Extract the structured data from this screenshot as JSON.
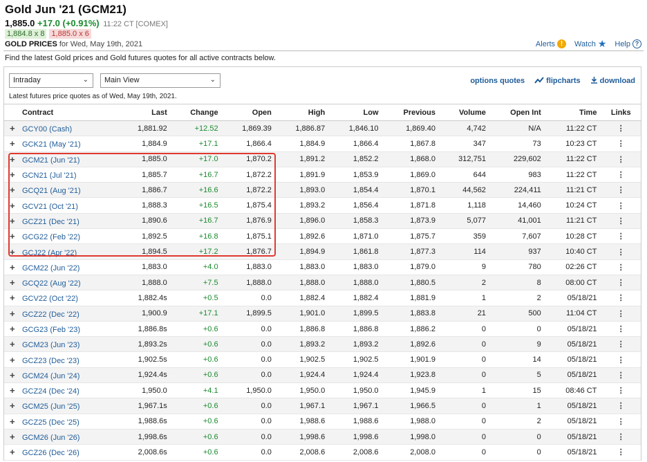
{
  "header": {
    "title": "Gold Jun '21 (GCM21)",
    "last": "1,885.0",
    "change": "+17.0 (+0.91%)",
    "time": "11:22 CT [COMEX]",
    "bid": "1,884.8 x 8",
    "ask": "1,885.0 x 6",
    "prices_label": "GOLD PRICES",
    "prices_date": "for Wed, May 19th, 2021"
  },
  "top_links": {
    "alerts": "Alerts",
    "watch": "Watch",
    "help": "Help"
  },
  "description": "Find the latest Gold prices and Gold futures quotes for all active contracts below.",
  "controls": {
    "view_type": "Intraday",
    "view_mode": "Main View",
    "options_quotes": "options quotes",
    "flipcharts": "flipcharts",
    "download": "download"
  },
  "latest_text": "Latest futures price quotes as of Wed, May 19th, 2021.",
  "table": {
    "headers": [
      "Contract",
      "Last",
      "Change",
      "Open",
      "High",
      "Low",
      "Previous",
      "Volume",
      "Open Int",
      "Time",
      "Links"
    ],
    "rows": [
      [
        "GCY00 (Cash)",
        "1,881.92",
        "+12.52",
        "1,869.39",
        "1,886.87",
        "1,846.10",
        "1,869.40",
        "4,742",
        "N/A",
        "11:22 CT"
      ],
      [
        "GCK21 (May '21)",
        "1,884.9",
        "+17.1",
        "1,866.4",
        "1,884.9",
        "1,866.4",
        "1,867.8",
        "347",
        "73",
        "10:23 CT"
      ],
      [
        "GCM21 (Jun '21)",
        "1,885.0",
        "+17.0",
        "1,870.2",
        "1,891.2",
        "1,852.2",
        "1,868.0",
        "312,751",
        "229,602",
        "11:22 CT"
      ],
      [
        "GCN21 (Jul '21)",
        "1,885.7",
        "+16.7",
        "1,872.2",
        "1,891.9",
        "1,853.9",
        "1,869.0",
        "644",
        "983",
        "11:22 CT"
      ],
      [
        "GCQ21 (Aug '21)",
        "1,886.7",
        "+16.6",
        "1,872.2",
        "1,893.0",
        "1,854.4",
        "1,870.1",
        "44,562",
        "224,411",
        "11:21 CT"
      ],
      [
        "GCV21 (Oct '21)",
        "1,888.3",
        "+16.5",
        "1,875.4",
        "1,893.2",
        "1,856.4",
        "1,871.8",
        "1,118",
        "14,460",
        "10:24 CT"
      ],
      [
        "GCZ21 (Dec '21)",
        "1,890.6",
        "+16.7",
        "1,876.9",
        "1,896.0",
        "1,858.3",
        "1,873.9",
        "5,077",
        "41,001",
        "11:21 CT"
      ],
      [
        "GCG22 (Feb '22)",
        "1,892.5",
        "+16.8",
        "1,875.1",
        "1,892.6",
        "1,871.0",
        "1,875.7",
        "359",
        "7,607",
        "10:28 CT"
      ],
      [
        "GCJ22 (Apr '22)",
        "1,894.5",
        "+17.2",
        "1,876.7",
        "1,894.9",
        "1,861.8",
        "1,877.3",
        "114",
        "937",
        "10:40 CT"
      ],
      [
        "GCM22 (Jun '22)",
        "1,883.0",
        "+4.0",
        "1,883.0",
        "1,883.0",
        "1,883.0",
        "1,879.0",
        "9",
        "780",
        "02:26 CT"
      ],
      [
        "GCQ22 (Aug '22)",
        "1,888.0",
        "+7.5",
        "1,888.0",
        "1,888.0",
        "1,888.0",
        "1,880.5",
        "2",
        "8",
        "08:00 CT"
      ],
      [
        "GCV22 (Oct '22)",
        "1,882.4s",
        "+0.5",
        "0.0",
        "1,882.4",
        "1,882.4",
        "1,881.9",
        "1",
        "2",
        "05/18/21"
      ],
      [
        "GCZ22 (Dec '22)",
        "1,900.9",
        "+17.1",
        "1,899.5",
        "1,901.0",
        "1,899.5",
        "1,883.8",
        "21",
        "500",
        "11:04 CT"
      ],
      [
        "GCG23 (Feb '23)",
        "1,886.8s",
        "+0.6",
        "0.0",
        "1,886.8",
        "1,886.8",
        "1,886.2",
        "0",
        "0",
        "05/18/21"
      ],
      [
        "GCM23 (Jun '23)",
        "1,893.2s",
        "+0.6",
        "0.0",
        "1,893.2",
        "1,893.2",
        "1,892.6",
        "0",
        "9",
        "05/18/21"
      ],
      [
        "GCZ23 (Dec '23)",
        "1,902.5s",
        "+0.6",
        "0.0",
        "1,902.5",
        "1,902.5",
        "1,901.9",
        "0",
        "14",
        "05/18/21"
      ],
      [
        "GCM24 (Jun '24)",
        "1,924.4s",
        "+0.6",
        "0.0",
        "1,924.4",
        "1,924.4",
        "1,923.8",
        "0",
        "5",
        "05/18/21"
      ],
      [
        "GCZ24 (Dec '24)",
        "1,950.0",
        "+4.1",
        "1,950.0",
        "1,950.0",
        "1,950.0",
        "1,945.9",
        "1",
        "15",
        "08:46 CT"
      ],
      [
        "GCM25 (Jun '25)",
        "1,967.1s",
        "+0.6",
        "0.0",
        "1,967.1",
        "1,967.1",
        "1,966.5",
        "0",
        "1",
        "05/18/21"
      ],
      [
        "GCZ25 (Dec '25)",
        "1,988.6s",
        "+0.6",
        "0.0",
        "1,988.6",
        "1,988.6",
        "1,988.0",
        "0",
        "2",
        "05/18/21"
      ],
      [
        "GCM26 (Jun '26)",
        "1,998.6s",
        "+0.6",
        "0.0",
        "1,998.6",
        "1,998.6",
        "1,998.0",
        "0",
        "0",
        "05/18/21"
      ],
      [
        "GCZ26 (Dec '26)",
        "2,008.6s",
        "+0.6",
        "0.0",
        "2,008.6",
        "2,008.6",
        "2,008.0",
        "0",
        "0",
        "05/18/21"
      ]
    ]
  },
  "icons": {
    "row_expand": "plus-icon",
    "row_menu": "kebab-menu-icon",
    "alerts": "alert-icon",
    "watch": "star-icon",
    "help": "help-icon"
  },
  "colors": {
    "positive": "#1a8a2e",
    "link": "#1f5c99",
    "highlight_box": "#e03a2f"
  }
}
